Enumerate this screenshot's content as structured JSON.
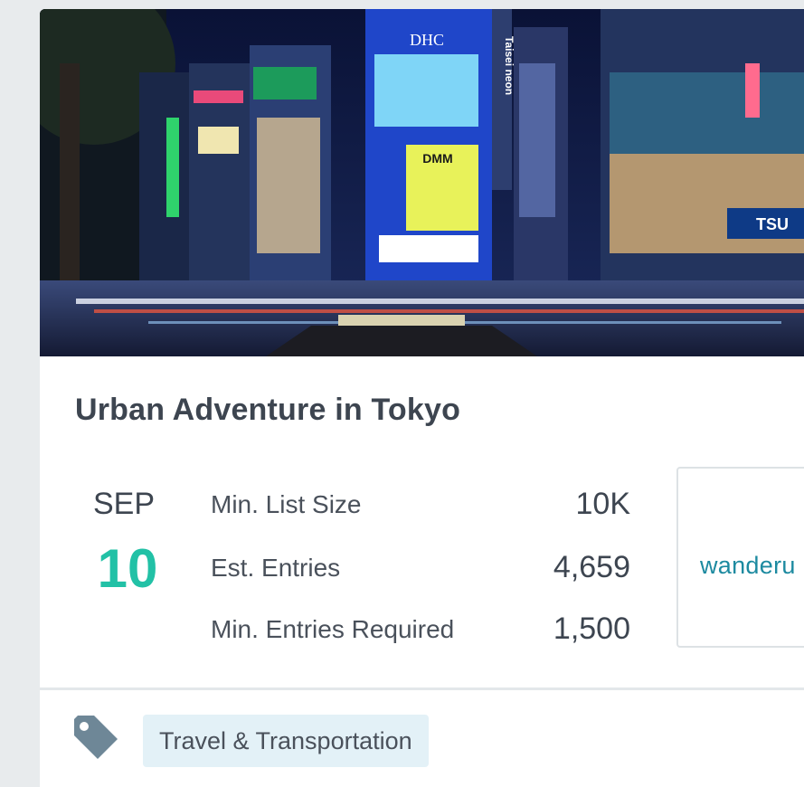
{
  "event": {
    "title": "Urban Adventure in Tokyo",
    "date": {
      "month": "SEP",
      "day": "10"
    },
    "stats": [
      {
        "label": "Min. List Size",
        "value": "10K"
      },
      {
        "label": "Est. Entries",
        "value": "4,659"
      },
      {
        "label": "Min. Entries Required",
        "value": "1,500"
      }
    ],
    "sponsor": {
      "name": "wanderu"
    },
    "tag": {
      "label": "Travel & Transportation",
      "icon": "tag-icon"
    },
    "hero_image": {
      "subject": "shibuya-crossing-night",
      "sign_texts": [
        "DHC",
        "DMM",
        "Taisei neon",
        "TSU"
      ]
    }
  },
  "colors": {
    "accent": "#22c1a6",
    "tag_background": "#e3f1f7",
    "tag_icon": "#6e8797",
    "sponsor_text": "#1d8aa0"
  }
}
